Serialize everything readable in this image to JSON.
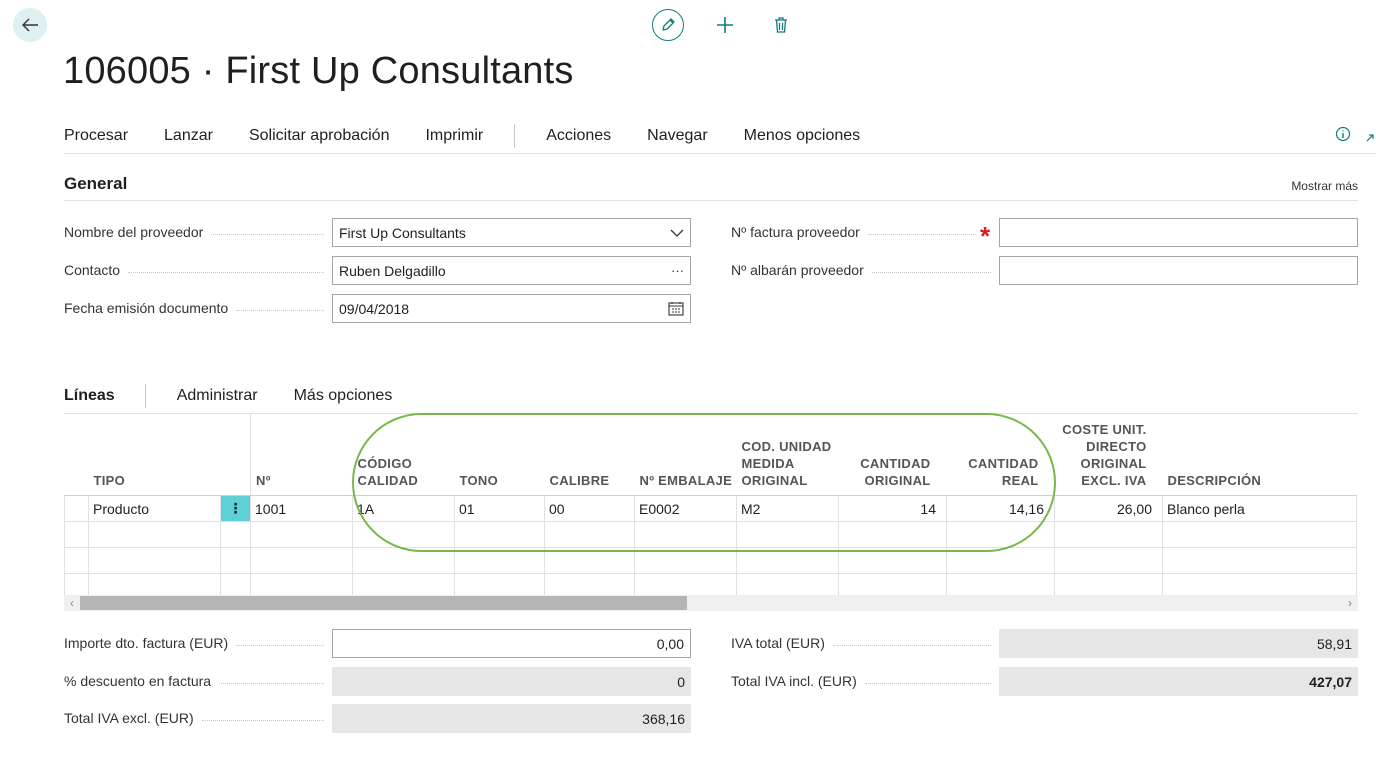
{
  "header": {
    "title": "106005 · First Up Consultants"
  },
  "actions": [
    "Procesar",
    "Lanzar",
    "Solicitar aprobación",
    "Imprimir",
    "Acciones",
    "Navegar",
    "Menos opciones"
  ],
  "general": {
    "title": "General",
    "show_more": "Mostrar más",
    "vendor_name": {
      "label": "Nombre del proveedor",
      "value": "First Up Consultants"
    },
    "contact": {
      "label": "Contacto",
      "value": "Ruben Delgadillo",
      "suffix": "···"
    },
    "doc_date": {
      "label": "Fecha emisión documento",
      "value": "09/04/2018"
    },
    "vendor_invoice_no": {
      "label": "Nº factura proveedor",
      "value": "",
      "required_mark": "*"
    },
    "vendor_shipment_no": {
      "label": "Nº albarán proveedor",
      "value": ""
    }
  },
  "lines": {
    "title": "Líneas",
    "actions": [
      "Administrar",
      "Más opciones"
    ],
    "columns": {
      "tipo": "TIPO",
      "no": "Nº",
      "codigo_calidad": "CÓDIGO CALIDAD",
      "tono": "TONO",
      "calibre": "CALIBRE",
      "embalaje": "Nº EMBALAJE",
      "cod_unidad": "COD. UNIDAD MEDIDA ORIGINAL",
      "cantidad_original": "CANTIDAD ORIGINAL",
      "cantidad_real": "CANTIDAD REAL",
      "coste": "COSTE UNIT. DIRECTO ORIGINAL EXCL. IVA",
      "descripcion": "DESCRIPCIÓN"
    },
    "row_menu": "⋮",
    "rows": [
      {
        "tipo": "Producto",
        "no": "1001",
        "codigo_calidad": "1A",
        "tono": "01",
        "calibre": "00",
        "embalaje": "E0002",
        "cod_unidad": "M2",
        "cantidad_original": "14",
        "cantidad_real": "14,16",
        "coste": "26,00",
        "descripcion": "Blanco perla"
      }
    ]
  },
  "totals": {
    "invoice_discount_amount": {
      "label": "Importe dto. factura (EUR)",
      "value": "0,00"
    },
    "invoice_discount_pct": {
      "label": "% descuento en factura",
      "value": "0"
    },
    "total_excl_vat": {
      "label": "Total IVA excl. (EUR)",
      "value": "368,16"
    },
    "total_vat": {
      "label": "IVA total (EUR)",
      "value": "58,91"
    },
    "total_incl_vat": {
      "label": "Total IVA incl. (EUR)",
      "value": "427,07"
    }
  },
  "colors": {
    "accent": "#0f7d7a",
    "highlight": "#7ab648",
    "required": "#d81e1e",
    "row_menu": "#5fd0d6"
  }
}
